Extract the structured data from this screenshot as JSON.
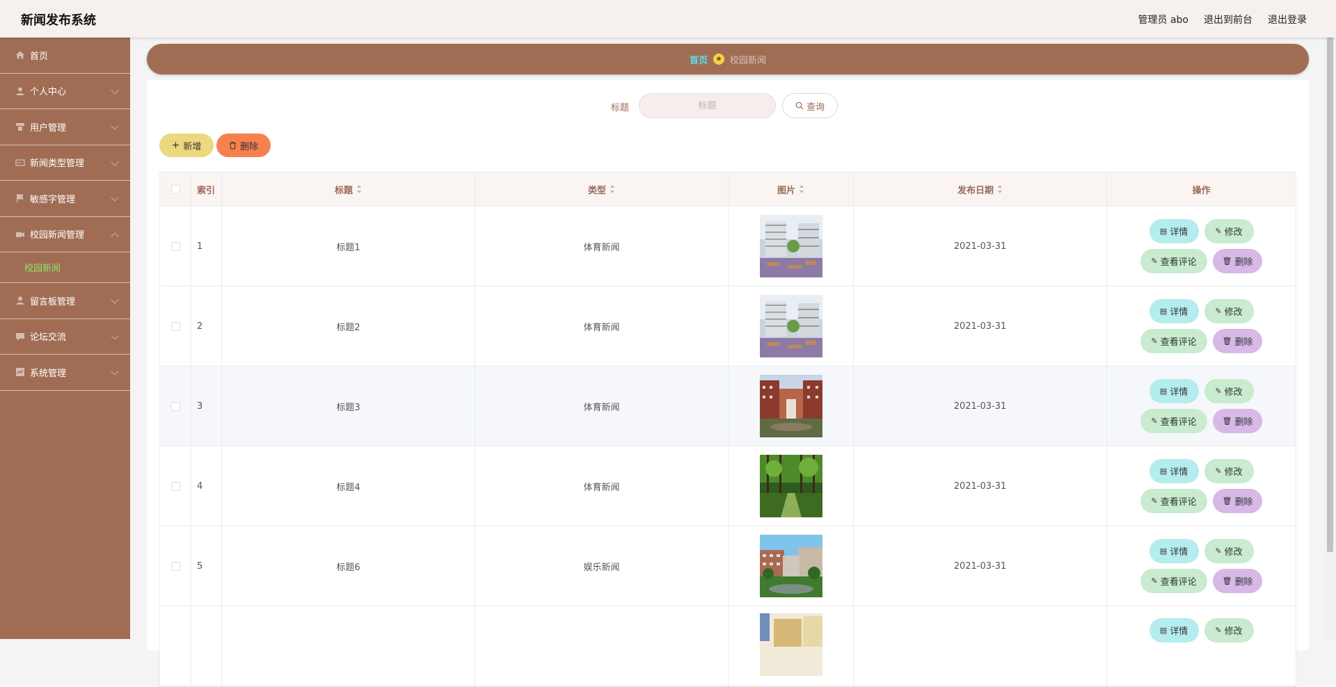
{
  "header": {
    "app_title": "新闻发布系统",
    "admin_label": "管理员 abo",
    "to_front_label": "退出到前台",
    "logout_label": "退出登录"
  },
  "sidebar": {
    "items": [
      {
        "label": "首页"
      },
      {
        "label": "个人中心"
      },
      {
        "label": "用户管理"
      },
      {
        "label": "新闻类型管理"
      },
      {
        "label": "敏感字管理"
      },
      {
        "label": "校园新闻管理"
      },
      {
        "label": "留言板管理"
      },
      {
        "label": "论坛交流"
      },
      {
        "label": "系统管理"
      }
    ],
    "sub_item": "校园新闻"
  },
  "breadcrumb": {
    "home": "首页",
    "current": "校园新闻"
  },
  "search": {
    "label": "标题",
    "placeholder": "标题",
    "query_label": "查询"
  },
  "actions": {
    "add_label": "新增",
    "delete_label": "删除"
  },
  "table": {
    "columns": {
      "index": "索引",
      "title": "标题",
      "type": "类型",
      "image": "图片",
      "date": "发布日期",
      "ops": "操作"
    },
    "op_labels": {
      "detail": "详情",
      "edit": "修改",
      "comment": "查看评论",
      "delete": "删除"
    },
    "rows": [
      {
        "index": "1",
        "title": "标题1",
        "type": "体育新闻",
        "date": "2021-03-31"
      },
      {
        "index": "2",
        "title": "标题2",
        "type": "体育新闻",
        "date": "2021-03-31"
      },
      {
        "index": "3",
        "title": "标题3",
        "type": "体育新闻",
        "date": "2021-03-31"
      },
      {
        "index": "4",
        "title": "标题4",
        "type": "体育新闻",
        "date": "2021-03-31"
      },
      {
        "index": "5",
        "title": "标题6",
        "type": "娱乐新闻",
        "date": "2021-03-31"
      },
      {
        "index": "",
        "title": "",
        "type": "",
        "date": ""
      }
    ]
  },
  "colors": {
    "sidebar": "#a06d54",
    "accent_home": "#5ae0f0",
    "active_sub": "#8de36a"
  }
}
